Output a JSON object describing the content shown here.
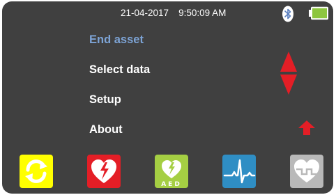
{
  "status": {
    "date": "21-04-2017",
    "time": "9:50:09 AM",
    "icons": {
      "bluetooth": "bluetooth-icon",
      "battery": "battery-icon"
    },
    "colors": {
      "battery_fill": "#8dc63f"
    }
  },
  "menu": {
    "items": [
      {
        "label": "End asset",
        "selected": true
      },
      {
        "label": "Select data",
        "selected": false
      },
      {
        "label": "Setup",
        "selected": false
      },
      {
        "label": "About",
        "selected": false
      }
    ],
    "colors": {
      "selected_text": "#7da4d6",
      "text": "#ffffff"
    }
  },
  "navigation": {
    "icons": [
      "up-down-arrows-icon",
      "back-arrow-icon"
    ],
    "color": "#e41e26"
  },
  "toolbar": {
    "buttons": [
      {
        "name": "refresh-button",
        "icon": "refresh-icon",
        "color": "#ffff00"
      },
      {
        "name": "broken-heart-button",
        "icon": "broken-heart-icon",
        "color": "#e41e26"
      },
      {
        "name": "aed-button",
        "icon": "aed-heart-icon",
        "color": "#a5cf43",
        "label": "AED"
      },
      {
        "name": "ecg-button",
        "icon": "ecg-waveform-icon",
        "color": "#2f8ec4"
      },
      {
        "name": "heart-download-button",
        "icon": "heart-download-icon",
        "color": "#b9b9b9"
      }
    ]
  }
}
